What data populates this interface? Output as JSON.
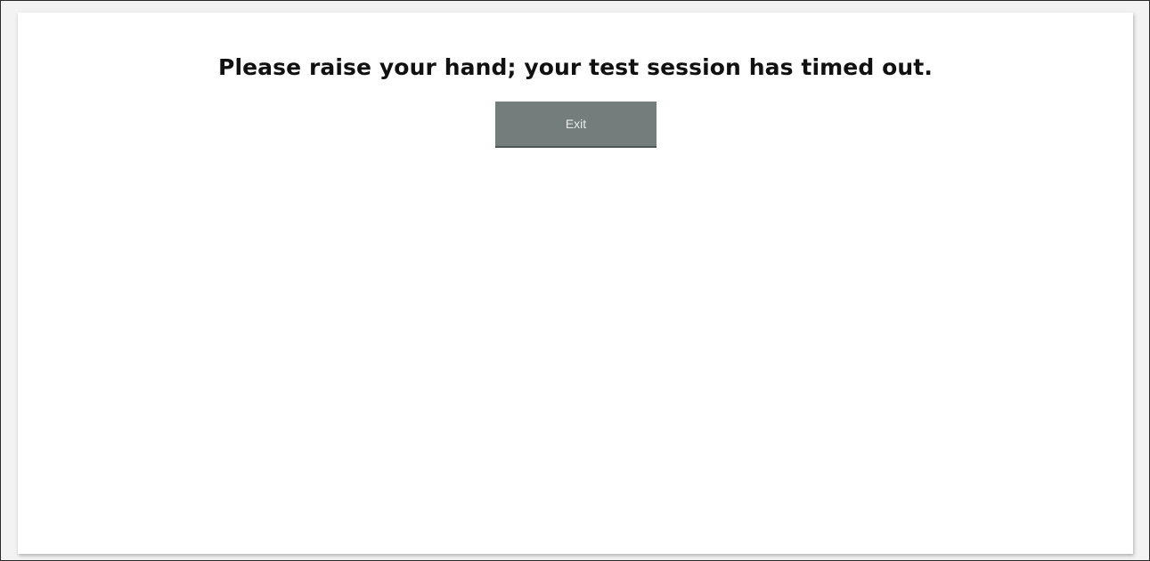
{
  "dialog": {
    "message": "Please raise your hand; your test session has timed out.",
    "exit_label": "Exit"
  },
  "colors": {
    "button_bg": "#737d7b",
    "button_text": "#e8ecec",
    "message_text": "#111111"
  }
}
